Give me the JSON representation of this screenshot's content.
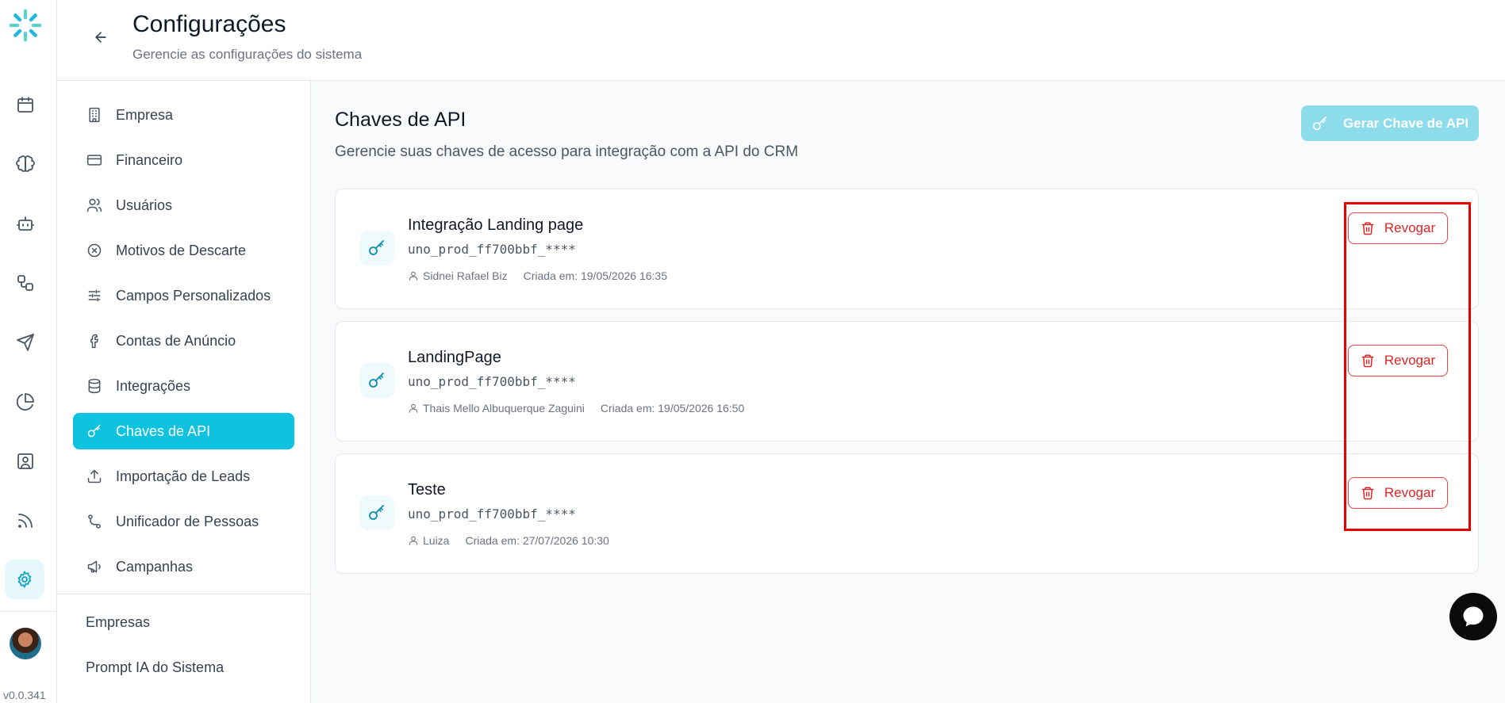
{
  "app": {
    "version": "v0.0.341",
    "accent_color": "#0ec2e0",
    "danger_color": "#dc2626"
  },
  "rail": {
    "icons": [
      "logo-icon",
      "calendar-icon",
      "brain-icon",
      "bot-icon",
      "workflow-icon",
      "send-icon",
      "pie-chart-icon",
      "contact-icon",
      "rss-icon",
      "gear-icon"
    ],
    "active": "gear-icon"
  },
  "header": {
    "title": "Configurações",
    "subtitle": "Gerencie as configurações do sistema"
  },
  "nav": {
    "items": [
      {
        "label": "Empresa",
        "icon": "building-icon"
      },
      {
        "label": "Financeiro",
        "icon": "credit-card-icon"
      },
      {
        "label": "Usuários",
        "icon": "users-icon"
      },
      {
        "label": "Motivos de Descarte",
        "icon": "circle-x-icon"
      },
      {
        "label": "Campos Personalizados",
        "icon": "sliders-icon"
      },
      {
        "label": "Contas de Anúncio",
        "icon": "facebook-icon"
      },
      {
        "label": "Integrações",
        "icon": "database-icon"
      },
      {
        "label": "Chaves de API",
        "icon": "key-icon",
        "active": true
      },
      {
        "label": "Importação de Leads",
        "icon": "upload-icon"
      },
      {
        "label": "Unificador de Pessoas",
        "icon": "merge-icon"
      },
      {
        "label": "Campanhas",
        "icon": "megaphone-icon"
      }
    ],
    "extra": [
      "Empresas",
      "Prompt IA do Sistema"
    ]
  },
  "main": {
    "title": "Chaves de API",
    "subtitle": "Gerencie suas chaves de acesso para integração com a API do CRM",
    "generate_label": "Gerar Chave de API",
    "revoke_label": "Revogar",
    "keys": [
      {
        "name": "Integração Landing page",
        "value": "uno_prod_ff700bbf_****",
        "user": "Sidnei Rafael Biz",
        "created": "Criada em: 19/05/2026 16:35"
      },
      {
        "name": "LandingPage",
        "value": "uno_prod_ff700bbf_****",
        "user": "Thais Mello Albuquerque Zaguini",
        "created": "Criada em: 19/05/2026 16:50"
      },
      {
        "name": "Teste",
        "value": "uno_prod_ff700bbf_****",
        "user": "Luiza",
        "created": "Criada em: 27/07/2026 10:30"
      }
    ]
  }
}
